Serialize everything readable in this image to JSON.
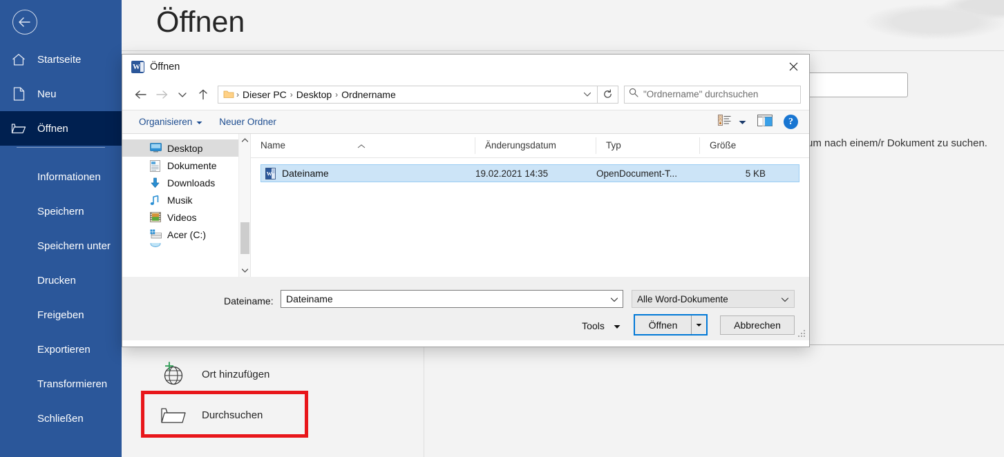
{
  "backstage": {
    "back_button": "back-arrow",
    "page_title": "Öffnen",
    "nav": [
      {
        "label": "Startseite",
        "icon": "home-icon",
        "active": false,
        "indent": false
      },
      {
        "label": "Neu",
        "icon": "new-document-icon",
        "active": false,
        "indent": false
      },
      {
        "label": "Öffnen",
        "icon": "open-folder-icon",
        "active": true,
        "indent": false
      },
      {
        "label": "Informationen",
        "icon": "",
        "active": false,
        "indent": true
      },
      {
        "label": "Speichern",
        "icon": "",
        "active": false,
        "indent": true
      },
      {
        "label": "Speichern unter",
        "icon": "",
        "active": false,
        "indent": true
      },
      {
        "label": "Drucken",
        "icon": "",
        "active": false,
        "indent": true
      },
      {
        "label": "Freigeben",
        "icon": "",
        "active": false,
        "indent": true
      },
      {
        "label": "Exportieren",
        "icon": "",
        "active": false,
        "indent": true
      },
      {
        "label": "Transformieren",
        "icon": "",
        "active": false,
        "indent": true
      },
      {
        "label": "Schließen",
        "icon": "",
        "active": false,
        "indent": true
      }
    ],
    "hint_text": "um nach einem/r Dokument zu suchen.",
    "places": [
      {
        "label": "Ort hinzufügen",
        "icon": "add-place-globe-icon"
      },
      {
        "label": "Durchsuchen",
        "icon": "browse-folder-icon"
      }
    ],
    "highlight_color": "#e8161a",
    "accent_color": "#2b579a",
    "active_color": "#002050"
  },
  "dialog": {
    "title": "Öffnen",
    "app_icon": "word-icon",
    "close_label": "×",
    "nav": {
      "back": "back-arrow-icon",
      "forward": "forward-arrow-icon",
      "recent": "chevron-down-icon",
      "up": "up-arrow-icon",
      "refresh": "refresh-icon"
    },
    "address": {
      "folder_icon": "folder-icon",
      "crumbs": [
        "Dieser PC",
        "Desktop",
        "Ordnername"
      ],
      "separator": "›",
      "dropdown": "chevron-down-icon"
    },
    "search": {
      "icon": "search-icon",
      "placeholder": "\"Ordnername\" durchsuchen",
      "value": ""
    },
    "toolbar": {
      "organize": "Organisieren",
      "organize_caret": "▾",
      "new_folder": "Neuer Ordner",
      "view_icon": "view-list-icon",
      "view_caret": "▾",
      "preview_icon": "preview-pane-icon",
      "help_icon": "help-icon",
      "help_glyph": "?"
    },
    "navpane": {
      "items": [
        {
          "label": "Desktop",
          "icon": "desktop-icon",
          "selected": true
        },
        {
          "label": "Dokumente",
          "icon": "documents-icon",
          "selected": false
        },
        {
          "label": "Downloads",
          "icon": "downloads-icon",
          "selected": false
        },
        {
          "label": "Musik",
          "icon": "music-icon",
          "selected": false
        },
        {
          "label": "Videos",
          "icon": "videos-icon",
          "selected": false
        },
        {
          "label": "Acer (C:)",
          "icon": "drive-icon",
          "selected": false
        }
      ],
      "scroll_up": "scroll-up-arrow",
      "scroll_down": "scroll-down-arrow"
    },
    "filelist": {
      "columns": [
        "Name",
        "Änderungsdatum",
        "Typ",
        "Größe"
      ],
      "sort_indicator": "˄",
      "rows": [
        {
          "icon": "word-document-icon",
          "name": "Dateiname",
          "modified": "19.02.2021 14:35",
          "type": "OpenDocument-T...",
          "size": "5 KB",
          "selected": true
        }
      ]
    },
    "footer": {
      "filename_label": "Dateiname:",
      "filename_value": "Dateiname",
      "filename_caret": "⌄",
      "filter_value": "Alle Word-Dokumente",
      "filter_caret": "⌄",
      "tools_label": "Tools",
      "tools_caret": "▾",
      "open_label": "Öffnen",
      "open_split_caret": "▾",
      "cancel_label": "Abbrechen",
      "resize_grip": "resize-grip"
    }
  }
}
